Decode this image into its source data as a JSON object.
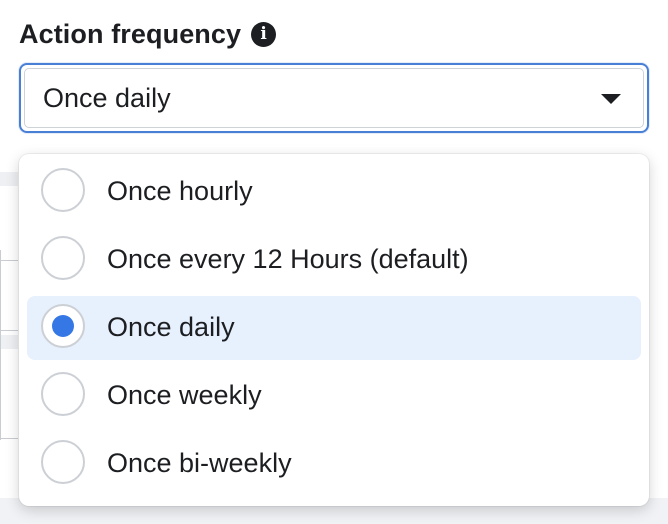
{
  "field": {
    "label": "Action frequency",
    "info_icon": "info-icon"
  },
  "select": {
    "value": "Once daily",
    "caret_icon": "caret-down-icon"
  },
  "menu": {
    "options": [
      {
        "label": "Once hourly",
        "selected": false
      },
      {
        "label": "Once every 12 Hours (default)",
        "selected": false
      },
      {
        "label": "Once daily",
        "selected": true
      },
      {
        "label": "Once weekly",
        "selected": false
      },
      {
        "label": "Once bi-weekly",
        "selected": false
      }
    ]
  },
  "colors": {
    "accent": "#3578e5",
    "selected_bg": "#e7f0fd",
    "focus_border": "#4a7fd6",
    "text": "#1c1e21"
  }
}
